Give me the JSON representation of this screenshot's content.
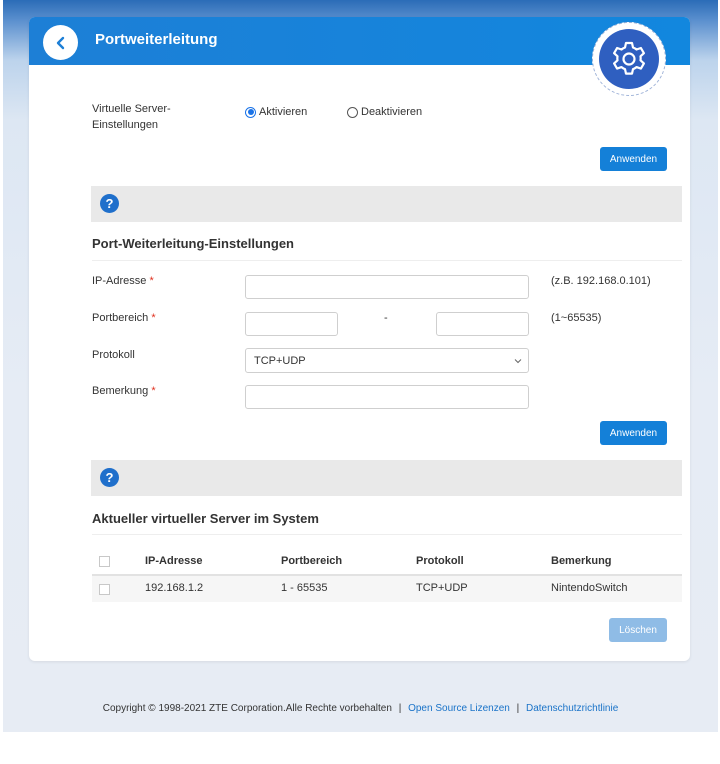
{
  "header": {
    "title": "Portweiterleitung"
  },
  "virtual_server": {
    "label": "Virtuelle Server-Einstellungen",
    "options": [
      "Aktivieren",
      "Deaktivieren"
    ],
    "selected": "Aktivieren",
    "apply": "Anwenden"
  },
  "port_forwarding": {
    "title": "Port-Weiterleitung-Einstellungen",
    "ip_label": "IP-Adresse",
    "ip_hint": "(z.B. 192.168.0.101)",
    "port_label": "Portbereich",
    "port_separator": "-",
    "port_hint": "(1~65535)",
    "protocol_label": "Protokoll",
    "protocol_value": "TCP+UDP",
    "remark_label": "Bemerkung",
    "required_mark": "*",
    "apply": "Anwenden"
  },
  "current_servers": {
    "title": "Aktueller virtueller Server im System",
    "columns": [
      "IP-Adresse",
      "Portbereich",
      "Protokoll",
      "Bemerkung"
    ],
    "rows": [
      {
        "ip": "192.168.1.2",
        "ports": "1 - 65535",
        "protocol": "TCP+UDP",
        "remark": "NintendoSwitch"
      }
    ],
    "delete": "Löschen"
  },
  "footer": {
    "copyright": "Copyright © 1998-2021 ZTE Corporation.Alle Rechte vorbehalten",
    "separator": "|",
    "link1": "Open Source Lizenzen",
    "link2": "Datenschutzrichtlinie"
  }
}
